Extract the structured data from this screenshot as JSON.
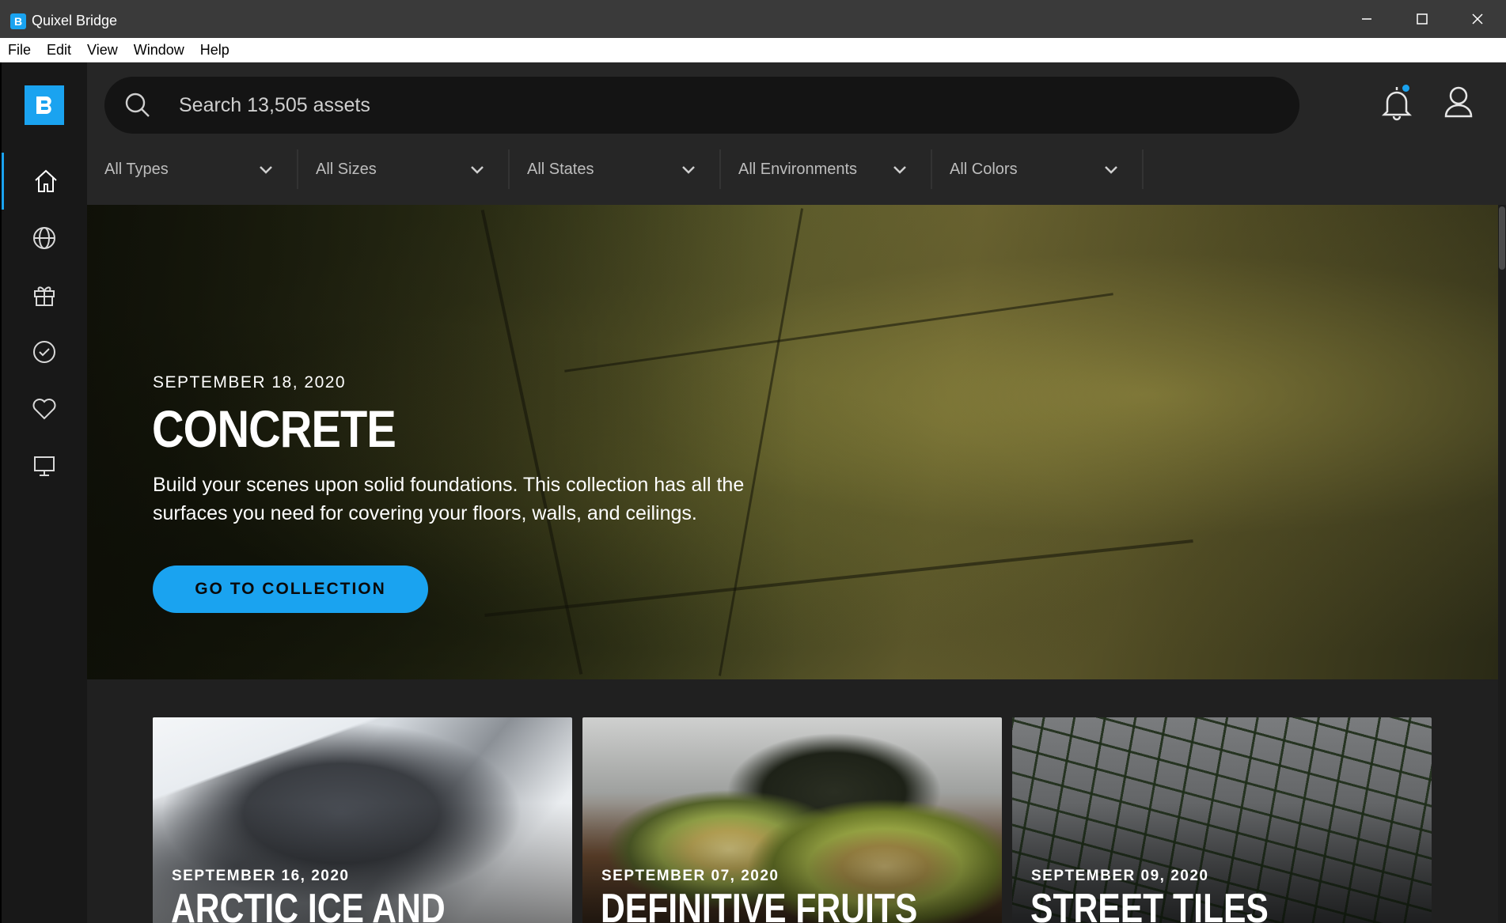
{
  "window": {
    "title": "Quixel Bridge",
    "app_icon": "B"
  },
  "menu": [
    "File",
    "Edit",
    "View",
    "Window",
    "Help"
  ],
  "sidebar": {
    "items": [
      {
        "icon": "home-icon",
        "active": true
      },
      {
        "icon": "globe-icon",
        "active": false
      },
      {
        "icon": "gift-icon",
        "active": false
      },
      {
        "icon": "check-circle-icon",
        "active": false
      },
      {
        "icon": "heart-icon",
        "active": false
      },
      {
        "icon": "monitor-icon",
        "active": false
      }
    ]
  },
  "search": {
    "placeholder": "Search 13,505 assets"
  },
  "filters": [
    {
      "label": "All Types"
    },
    {
      "label": "All Sizes"
    },
    {
      "label": "All States"
    },
    {
      "label": "All Environments"
    },
    {
      "label": "All Colors"
    }
  ],
  "hero": {
    "date": "SEPTEMBER 18, 2020",
    "title": "CONCRETE",
    "description": "Build your scenes upon solid foundations. This collection has all the surfaces you need for covering your floors, walls, and ceilings.",
    "cta": "GO TO COLLECTION"
  },
  "cards": [
    {
      "date": "SEPTEMBER 16, 2020",
      "title": "ARCTIC ICE AND"
    },
    {
      "date": "SEPTEMBER 07, 2020",
      "title": "DEFINITIVE FRUITS"
    },
    {
      "date": "SEPTEMBER 09, 2020",
      "title": "STREET TILES"
    }
  ],
  "colors": {
    "accent": "#1aa3f0",
    "sidebar_bg": "#181818",
    "topbar_bg": "#262626",
    "content_bg": "#202020"
  }
}
